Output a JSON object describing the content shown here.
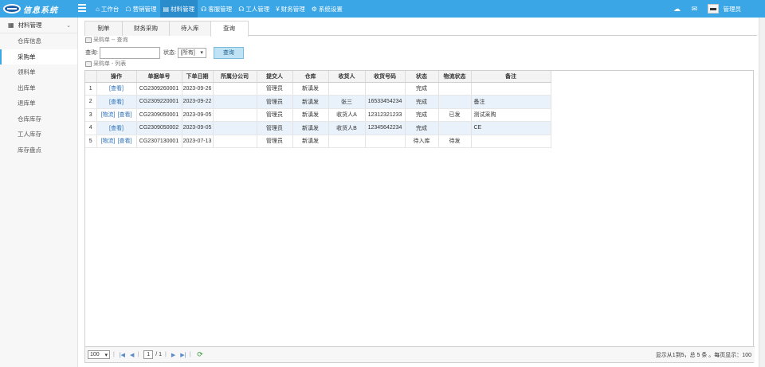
{
  "app": {
    "logo_text": "信息系统"
  },
  "nav": [
    {
      "icon": "⌂",
      "label": "工作台",
      "name": "nav-workbench"
    },
    {
      "icon": "☖",
      "label": "营销管理",
      "name": "nav-marketing"
    },
    {
      "icon": "▤",
      "label": "材料管理",
      "name": "nav-materials"
    },
    {
      "icon": "☊",
      "label": "客服管理",
      "name": "nav-service"
    },
    {
      "icon": "☊",
      "label": "工人管理",
      "name": "nav-workers"
    },
    {
      "icon": "¥",
      "label": "财务管理",
      "name": "nav-finance"
    },
    {
      "icon": "⚙",
      "label": "系统设置",
      "name": "nav-settings"
    }
  ],
  "user": {
    "name": "管理员"
  },
  "sidebar": {
    "header": "材料管理",
    "items": [
      "仓库信息",
      "采购单",
      "领料单",
      "出库单",
      "退库单",
      "仓库库存",
      "工人库存",
      "库存盘点"
    ]
  },
  "tabs": [
    "制单",
    "财务采购",
    "待入库",
    "查询"
  ],
  "query": {
    "section_title": "采购单 -- 查询",
    "search_label": "查询:",
    "search_value": "",
    "status_label": "状态:",
    "status_value": "[所有]",
    "button_label": "查询"
  },
  "list": {
    "section_title": "采购单 - 列表",
    "columns": [
      "",
      "操作",
      "单据单号",
      "下单日期",
      "所属分公司",
      "提交人",
      "仓库",
      "收货人",
      "收货号码",
      "状态",
      "物流状态",
      "备注"
    ],
    "rows": [
      {
        "n": "1",
        "ops": [
          "[查看]"
        ],
        "no": "CG2309260001",
        "date": "2023-09-26",
        "branch": "",
        "submitter": "管理员",
        "warehouse": "新滇发",
        "receiver": "",
        "phone": "",
        "status": "完成",
        "logistics": "",
        "note": ""
      },
      {
        "n": "2",
        "ops": [
          "[查看]"
        ],
        "no": "CG2309220001",
        "date": "2023-09-22",
        "branch": "",
        "submitter": "管理员",
        "warehouse": "新滇发",
        "receiver": "张三",
        "phone": "16533454234",
        "status": "完成",
        "logistics": "",
        "note": "备注"
      },
      {
        "n": "3",
        "ops": [
          "[物流]",
          "[查看]"
        ],
        "no": "CG2309050001",
        "date": "2023-09-05",
        "branch": "",
        "submitter": "管理员",
        "warehouse": "新滇发",
        "receiver": "收货人A",
        "phone": "12312321233",
        "status": "完成",
        "logistics": "已发",
        "note": "测试采购"
      },
      {
        "n": "4",
        "ops": [
          "[查看]"
        ],
        "no": "CG2309050002",
        "date": "2023-09-05",
        "branch": "",
        "submitter": "管理员",
        "warehouse": "新滇发",
        "receiver": "收货人B",
        "phone": "12345642234",
        "status": "完成",
        "logistics": "",
        "note": "CE"
      },
      {
        "n": "5",
        "ops": [
          "[物流]",
          "[查看]"
        ],
        "no": "CG2307130001",
        "date": "2023-07-13",
        "branch": "",
        "submitter": "管理员",
        "warehouse": "新滇发",
        "receiver": "",
        "phone": "",
        "status": "待入库",
        "logistics": "待发",
        "note": ""
      }
    ]
  },
  "pager": {
    "page_size": "100",
    "page": "1",
    "total_pages": "/ 1",
    "info": "显示从1到5，总 5 条 。每页显示：100"
  }
}
